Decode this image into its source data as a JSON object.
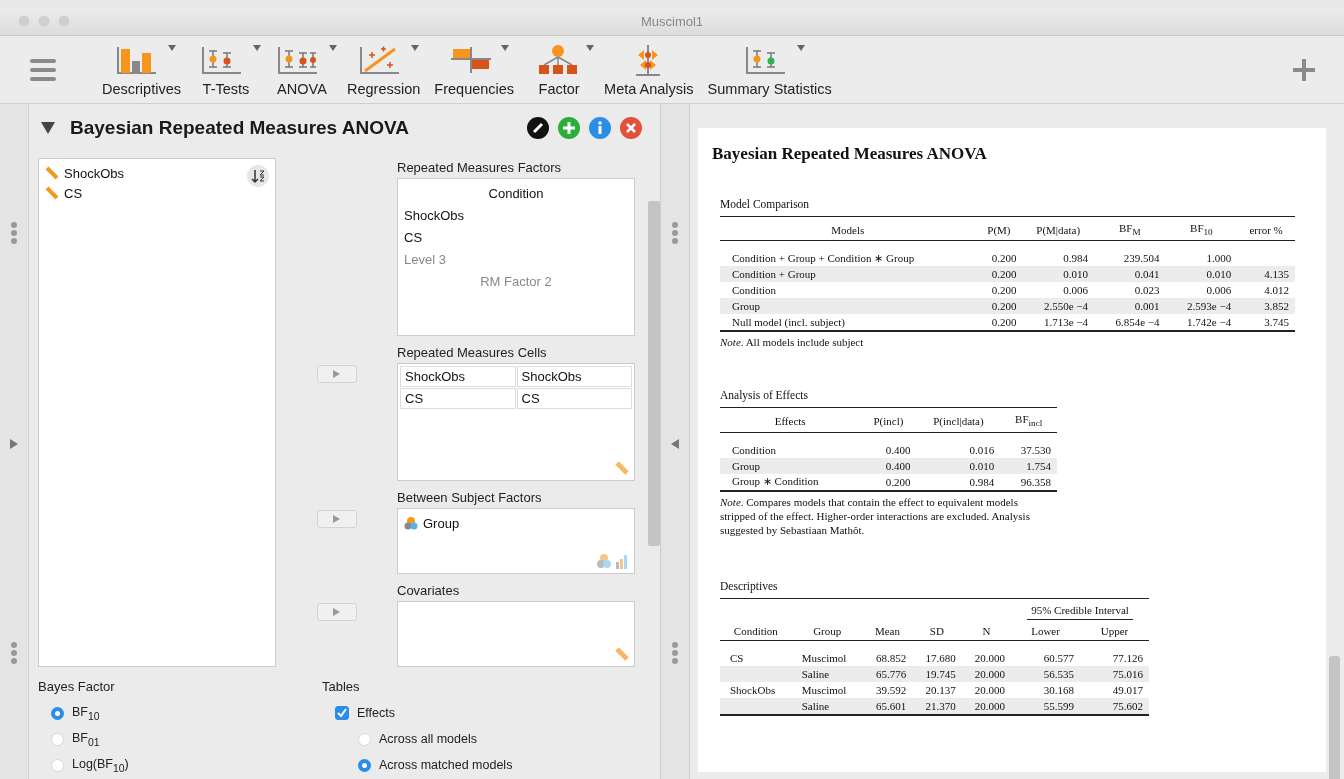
{
  "window": {
    "title": "Muscimol1"
  },
  "toolbar": {
    "items": [
      {
        "label": "Descriptives",
        "kind": "descriptives",
        "menu": true
      },
      {
        "label": "T-Tests",
        "kind": "ttest",
        "menu": true
      },
      {
        "label": "ANOVA",
        "kind": "anova",
        "menu": true
      },
      {
        "label": "Regression",
        "kind": "regression",
        "menu": true
      },
      {
        "label": "Frequencies",
        "kind": "frequencies",
        "menu": true
      },
      {
        "label": "Factor",
        "kind": "factor",
        "menu": true
      },
      {
        "label": "Meta Analysis",
        "kind": "meta",
        "menu": false
      },
      {
        "label": "Summary Statistics",
        "kind": "summary",
        "menu": true
      }
    ]
  },
  "analysis": {
    "title": "Bayesian Repeated Measures ANOVA",
    "expanded": true,
    "variables": [
      {
        "name": "ShockObs",
        "kind": "scale"
      },
      {
        "name": "CS",
        "kind": "scale"
      }
    ],
    "rm_factors": {
      "label": "Repeated Measures Factors",
      "factors": [
        {
          "name": "Condition",
          "levels": [
            {
              "label": "ShockObs",
              "placeholder": false
            },
            {
              "label": "CS",
              "placeholder": false
            },
            {
              "label": "Level 3",
              "placeholder": true
            }
          ]
        }
      ],
      "new_factor_placeholder": "RM Factor 2"
    },
    "rm_cells": {
      "label": "Repeated Measures Cells",
      "rows": [
        [
          "ShockObs",
          "ShockObs"
        ],
        [
          "CS",
          "CS"
        ]
      ]
    },
    "between": {
      "label": "Between Subject Factors",
      "items": [
        {
          "name": "Group",
          "kind": "nominal"
        }
      ]
    },
    "covariates": {
      "label": "Covariates"
    },
    "bayes_factor": {
      "label": "Bayes Factor",
      "options": [
        {
          "label": "BF$_{10}$",
          "selected": true
        },
        {
          "label": "BF$_{01}$",
          "selected": false
        },
        {
          "label": "Log(BF$_{10}$)",
          "selected": false
        }
      ]
    },
    "tables": {
      "label": "Tables",
      "effects": {
        "label": "Effects",
        "checked": true
      },
      "options": [
        {
          "label": "Across all models",
          "selected": false
        },
        {
          "label": "Across matched models",
          "selected": true
        }
      ]
    }
  },
  "output": {
    "title": "Bayesian Repeated Measures ANOVA",
    "model_comparison": {
      "title": "Model Comparison",
      "columns": [
        "Models",
        "P(M)",
        "P(M|data)",
        "BF$_{M}$",
        "BF$_{10}$",
        "error %"
      ],
      "rows": [
        {
          "model": "Condition + Group + Condition ∗ Group",
          "values": [
            "0.200",
            "0.984",
            "239.504",
            "1.000"
          ]
        },
        {
          "model": "Condition + Group",
          "values": [
            "0.200",
            "0.010",
            "0.041",
            "0.010",
            "4.135"
          ]
        },
        {
          "model": "Condition",
          "values": [
            "0.200",
            "0.006",
            "0.023",
            "0.006",
            "4.012"
          ]
        },
        {
          "model": "Group",
          "values": [
            "0.200",
            "2.550e −4",
            "0.001",
            "2.593e −4",
            "3.852"
          ]
        },
        {
          "model": "Null model (incl. subject)",
          "values": [
            "0.200",
            "1.713e −4",
            "6.854e −4",
            "1.742e −4",
            "3.745"
          ]
        }
      ],
      "note": "*Note*. All models include subject"
    },
    "effects": {
      "title": "Analysis of Effects",
      "columns": [
        "Effects",
        "P(incl)",
        "P(incl|data)",
        "BF$_{incl}$"
      ],
      "rows": [
        {
          "effect": "Condition",
          "values": [
            "0.400",
            "0.016",
            "37.530"
          ]
        },
        {
          "effect": "Group",
          "values": [
            "0.400",
            "0.010",
            "1.754"
          ]
        },
        {
          "effect": "Group ∗ Condition",
          "values": [
            "0.200",
            "0.984",
            "96.358"
          ]
        }
      ],
      "note": "*Note*. Compares models that contain the effect to equivalent models stripped of the effect. Higher-order interactions are excluded. Analysis suggested by Sebastiaan Mathôt."
    },
    "descriptives": {
      "title": "Descriptives",
      "group_header": "95% Credible Interval",
      "columns": [
        "Condition",
        "Group",
        "Mean",
        "SD",
        "N",
        "Lower",
        "Upper"
      ],
      "rows": [
        {
          "condition": "CS",
          "group": "Muscimol",
          "values": [
            "68.852",
            "17.680",
            "20.000",
            "60.577",
            "77.126"
          ]
        },
        {
          "group": "Saline",
          "values": [
            "65.776",
            "19.745",
            "20.000",
            "56.535",
            "75.016"
          ]
        },
        {
          "condition": "ShockObs",
          "group": "Muscimol",
          "values": [
            "39.592",
            "20.137",
            "20.000",
            "30.168",
            "49.017"
          ]
        },
        {
          "group": "Saline",
          "values": [
            "65.601",
            "21.370",
            "20.000",
            "55.599",
            "75.602"
          ]
        }
      ]
    }
  }
}
